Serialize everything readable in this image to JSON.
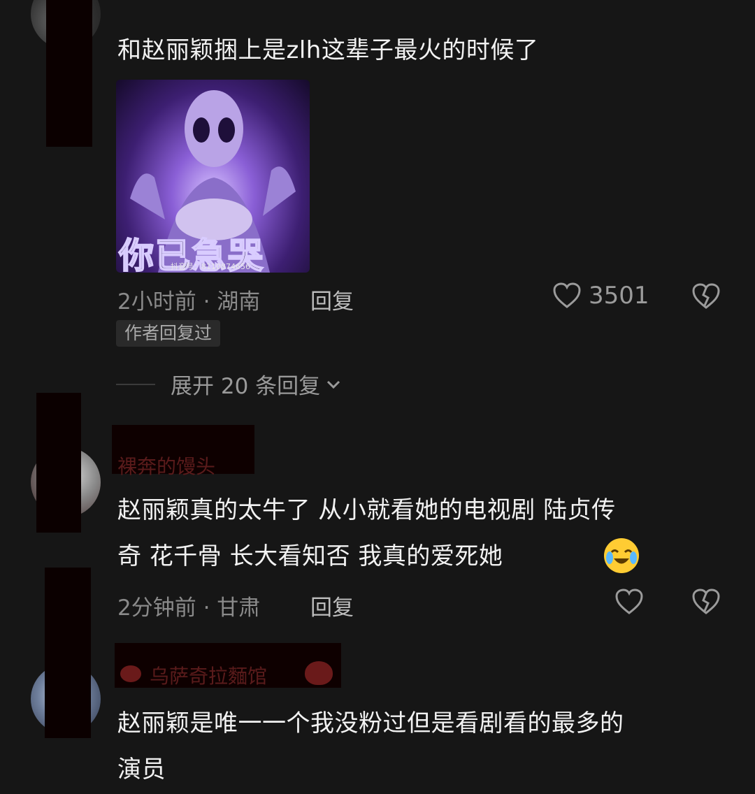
{
  "comments": [
    {
      "text": "和赵丽颖捆上是zlh这辈子最火的时候了",
      "image_caption": "你已急哭",
      "image_watermark": "抖音号：8110874656",
      "time_location": "2小时前 · 湖南",
      "reply_label": "回复",
      "like_count": "3501",
      "author_replied_badge": "作者回复过",
      "expand_label": "展开 20 条回复"
    },
    {
      "username": "裸奔的馒头",
      "text_line1": "赵丽颖真的太牛了  从小就看她的电视剧  陆贞传",
      "text_line2": "奇  花千骨  长大看知否  我真的爱死她",
      "emoji": "crying-laughing",
      "time_location": "2分钟前 · 甘肃",
      "reply_label": "回复"
    },
    {
      "username": "乌萨奇拉麵馆",
      "text_line1": "赵丽颖是唯一一个我没粉过但是看剧看的最多的",
      "text_line2": "演员"
    }
  ],
  "icons": {
    "like": "heart-icon",
    "dislike": "broken-heart-icon",
    "expand": "chevron-down-icon"
  }
}
